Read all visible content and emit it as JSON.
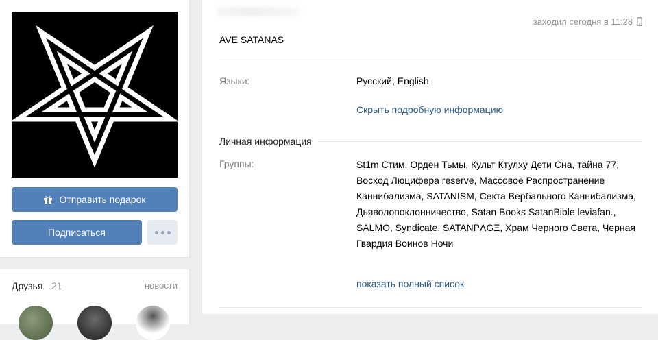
{
  "profile": {
    "last_seen": "заходил сегодня в 11:28",
    "status": "AVE SATANAS"
  },
  "actions": {
    "gift_label": "Отправить подарок",
    "subscribe_label": "Подписаться"
  },
  "friends": {
    "title": "Друзья",
    "count": "21",
    "news_label": "новости"
  },
  "info": {
    "languages_label": "Языки:",
    "languages_value": "Русский, English",
    "hide_details_label": "Скрыть подробную информацию",
    "personal_section": "Личная информация",
    "groups_label": "Группы:",
    "groups_text": "St1m Стим, Орден Тьмы, Культ Ктулху Дети Сна, тайна 77, Восход Люцифера reserve, Массовое Распространение Каннибализма, SATANISM, Секта Вербального Каннибализма, Дьяволопоклонничество, Satan Books SatanBible leviafan., SALMO, Syndicate, SATANPΛGΞ, Храм Черного Света, Черная Гвардия Воинов Ночи",
    "show_full_list_label": "показать полный список"
  },
  "colors": {
    "accent": "#5181b8",
    "link": "#2a5885",
    "muted": "#828282",
    "background": "#edeef0"
  },
  "icons": {
    "avatar": "pentagram-icon",
    "gift": "gift-icon",
    "more": "more-dots-icon",
    "online": "mobile-phone-icon"
  }
}
